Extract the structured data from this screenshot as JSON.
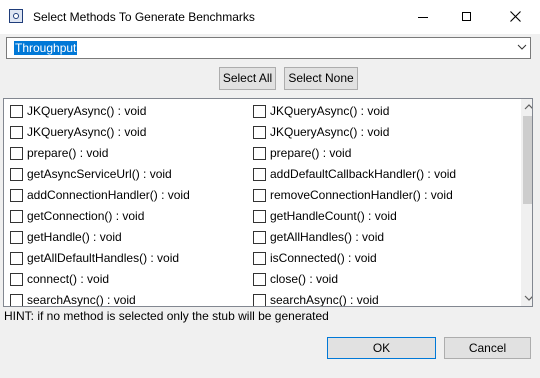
{
  "window": {
    "title": "Select Methods To Generate Benchmarks",
    "icon": "app-icon",
    "controls": [
      "minimize-icon",
      "maximize-icon",
      "close-icon"
    ]
  },
  "mode_select": {
    "value": "Throughput"
  },
  "toolbar": {
    "select_all": "Select All",
    "select_none": "Select None"
  },
  "methods": {
    "left": [
      {
        "label": "JKQueryAsync() : void",
        "checked": false
      },
      {
        "label": "JKQueryAsync() : void",
        "checked": false
      },
      {
        "label": "prepare() : void",
        "checked": false
      },
      {
        "label": "getAsyncServiceUrl() : void",
        "checked": false
      },
      {
        "label": "addConnectionHandler() : void",
        "checked": false
      },
      {
        "label": "getConnection() : void",
        "checked": false
      },
      {
        "label": "getHandle() : void",
        "checked": false
      },
      {
        "label": "getAllDefaultHandles() : void",
        "checked": false
      },
      {
        "label": "connect() : void",
        "checked": false
      },
      {
        "label": "searchAsync() : void",
        "checked": false
      }
    ],
    "right": [
      {
        "label": "JKQueryAsync() : void",
        "checked": false
      },
      {
        "label": "JKQueryAsync() : void",
        "checked": false
      },
      {
        "label": "prepare() : void",
        "checked": false
      },
      {
        "label": "addDefaultCallbackHandler() : void",
        "checked": false
      },
      {
        "label": "removeConnectionHandler() : void",
        "checked": false
      },
      {
        "label": "getHandleCount() : void",
        "checked": false
      },
      {
        "label": "getAllHandles() : void",
        "checked": false
      },
      {
        "label": "isConnected() : void",
        "checked": false
      },
      {
        "label": "close() : void",
        "checked": false
      },
      {
        "label": "searchAsync() : void",
        "checked": false
      }
    ]
  },
  "hint": "HINT: if no method is selected only the stub will be generated",
  "footer": {
    "ok": "OK",
    "cancel": "Cancel"
  },
  "colors": {
    "selection": "#0078d7",
    "dialog_bg": "#f0f0f0"
  }
}
